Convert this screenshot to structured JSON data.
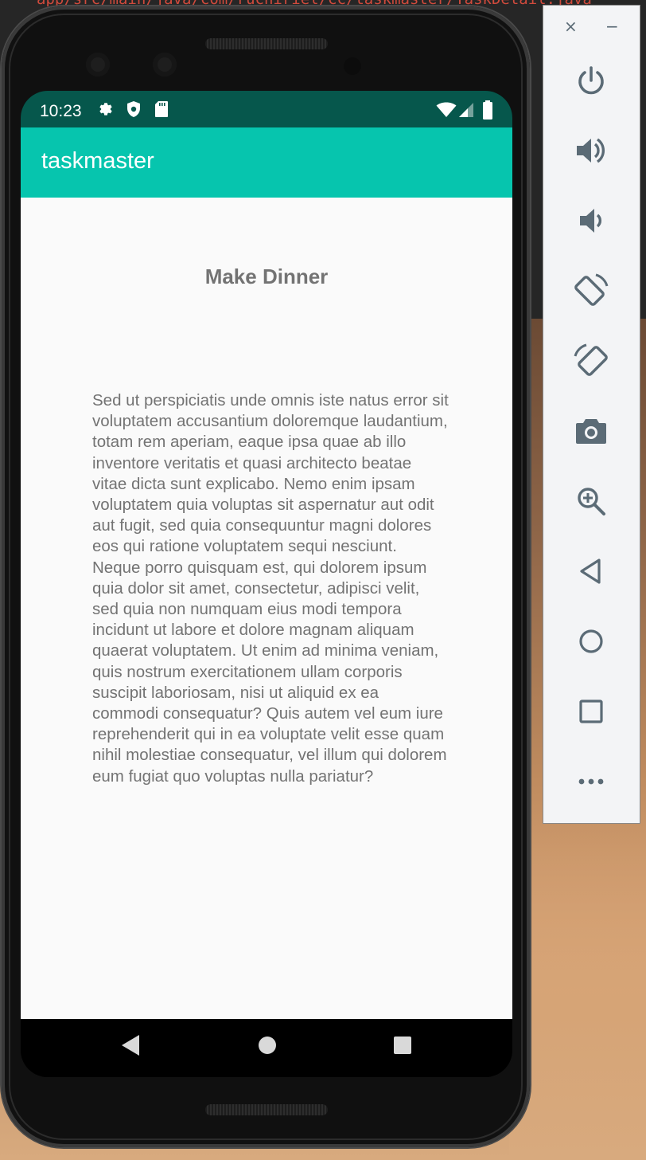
{
  "ide": {
    "path_text": "app/src/main/java/com/ruchiriel/cc/taskmaster/TaskDetail.java"
  },
  "status_bar": {
    "time": "10:23",
    "icons": [
      "settings-icon",
      "shield-icon",
      "sd-card-icon",
      "wifi-icon",
      "signal-icon",
      "battery-icon"
    ]
  },
  "app_bar": {
    "title": "taskmaster",
    "color": "#06c5ae",
    "status_color": "#06574c"
  },
  "task": {
    "title": "Make Dinner",
    "body": "Sed ut perspiciatis unde omnis iste natus error sit voluptatem accusantium doloremque laudantium, totam rem aperiam, eaque ipsa quae ab illo inventore veritatis et quasi architecto beatae vitae dicta sunt explicabo. Nemo enim ipsam voluptatem quia voluptas sit aspernatur aut odit aut fugit, sed quia consequuntur magni dolores eos qui ratione voluptatem sequi nesciunt. Neque porro quisquam est, qui dolorem ipsum quia dolor sit amet, consectetur, adipisci velit, sed quia non numquam eius modi tempora incidunt ut labore et dolore magnam aliquam quaerat voluptatem. Ut enim ad minima veniam, quis nostrum exercitationem ullam corporis suscipit laboriosam, nisi ut aliquid ex ea commodi consequatur? Quis autem vel eum iure reprehenderit qui in ea voluptate velit esse quam nihil molestiae consequatur, vel illum qui dolorem eum fugiat quo voluptas nulla pariatur?"
  },
  "nav_bar": {
    "buttons": [
      "back-icon",
      "home-icon",
      "recents-icon"
    ]
  },
  "emulator_panel": {
    "window_controls": {
      "close": "×",
      "minimize": "−"
    },
    "buttons": [
      "power-icon",
      "volume-up-icon",
      "volume-down-icon",
      "rotate-left-icon",
      "rotate-right-icon",
      "camera-icon",
      "zoom-icon",
      "back-icon",
      "home-icon",
      "overview-icon",
      "more-icon"
    ]
  }
}
